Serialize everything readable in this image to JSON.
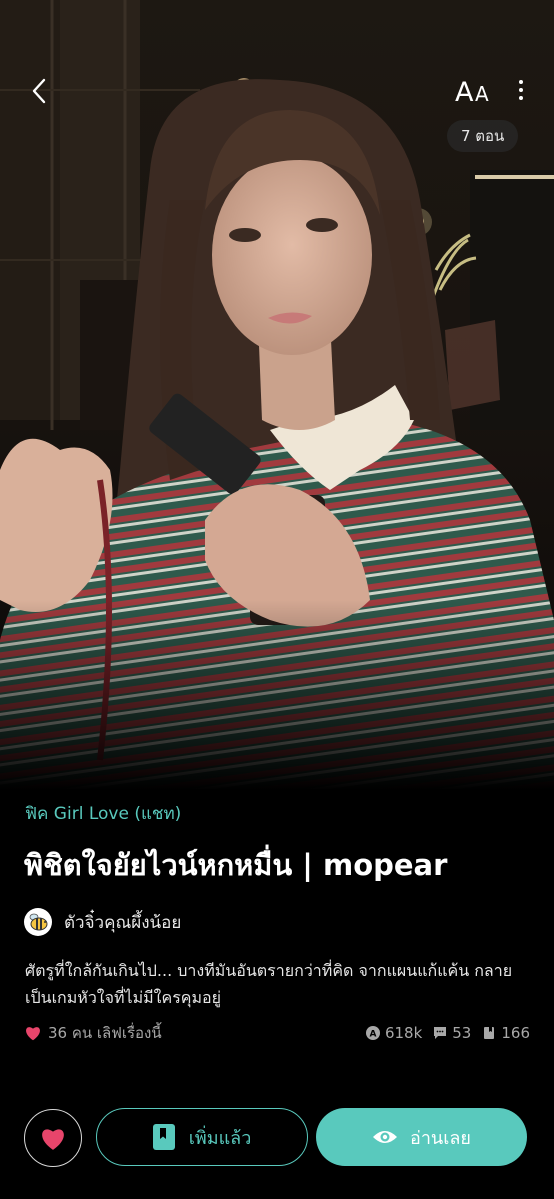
{
  "top_bar": {
    "font_label": "AA",
    "episode_count": "7 ตอน"
  },
  "story": {
    "category": "ฟิค Girl Love (แชท)",
    "title": "พิชิตใจยัยไวน์หกหมื่น | mopear",
    "author": "ตัวจิ๋วคุณผึ้งน้อย",
    "synopsis": "ศัตรูที่ใกล้กันเกินไป... บางทีมันอันตรายกว่าที่คิด จากแผนแก้แค้น กลายเป็นเกมหัวใจที่ไม่มีใครคุมอยู่",
    "likes_text": "36 คน เลิฟเรื่องนี้",
    "views": "618k",
    "comments": "53",
    "saves": "166"
  },
  "actions": {
    "library_label": "เพิ่มแล้ว",
    "read_label": "อ่านเลย"
  },
  "colors": {
    "accent": "#59c9bd",
    "heart": "#e8456b",
    "background": "#000000"
  },
  "icons": {
    "back": "chevron-left-icon",
    "font": "font-size-icon",
    "more": "more-vertical-icon",
    "heart": "heart-icon",
    "views": "view-count-icon",
    "comments": "comment-icon",
    "saves": "bookmark-icon",
    "library": "book-icon",
    "read": "eye-icon",
    "author": "bee-avatar-icon"
  }
}
